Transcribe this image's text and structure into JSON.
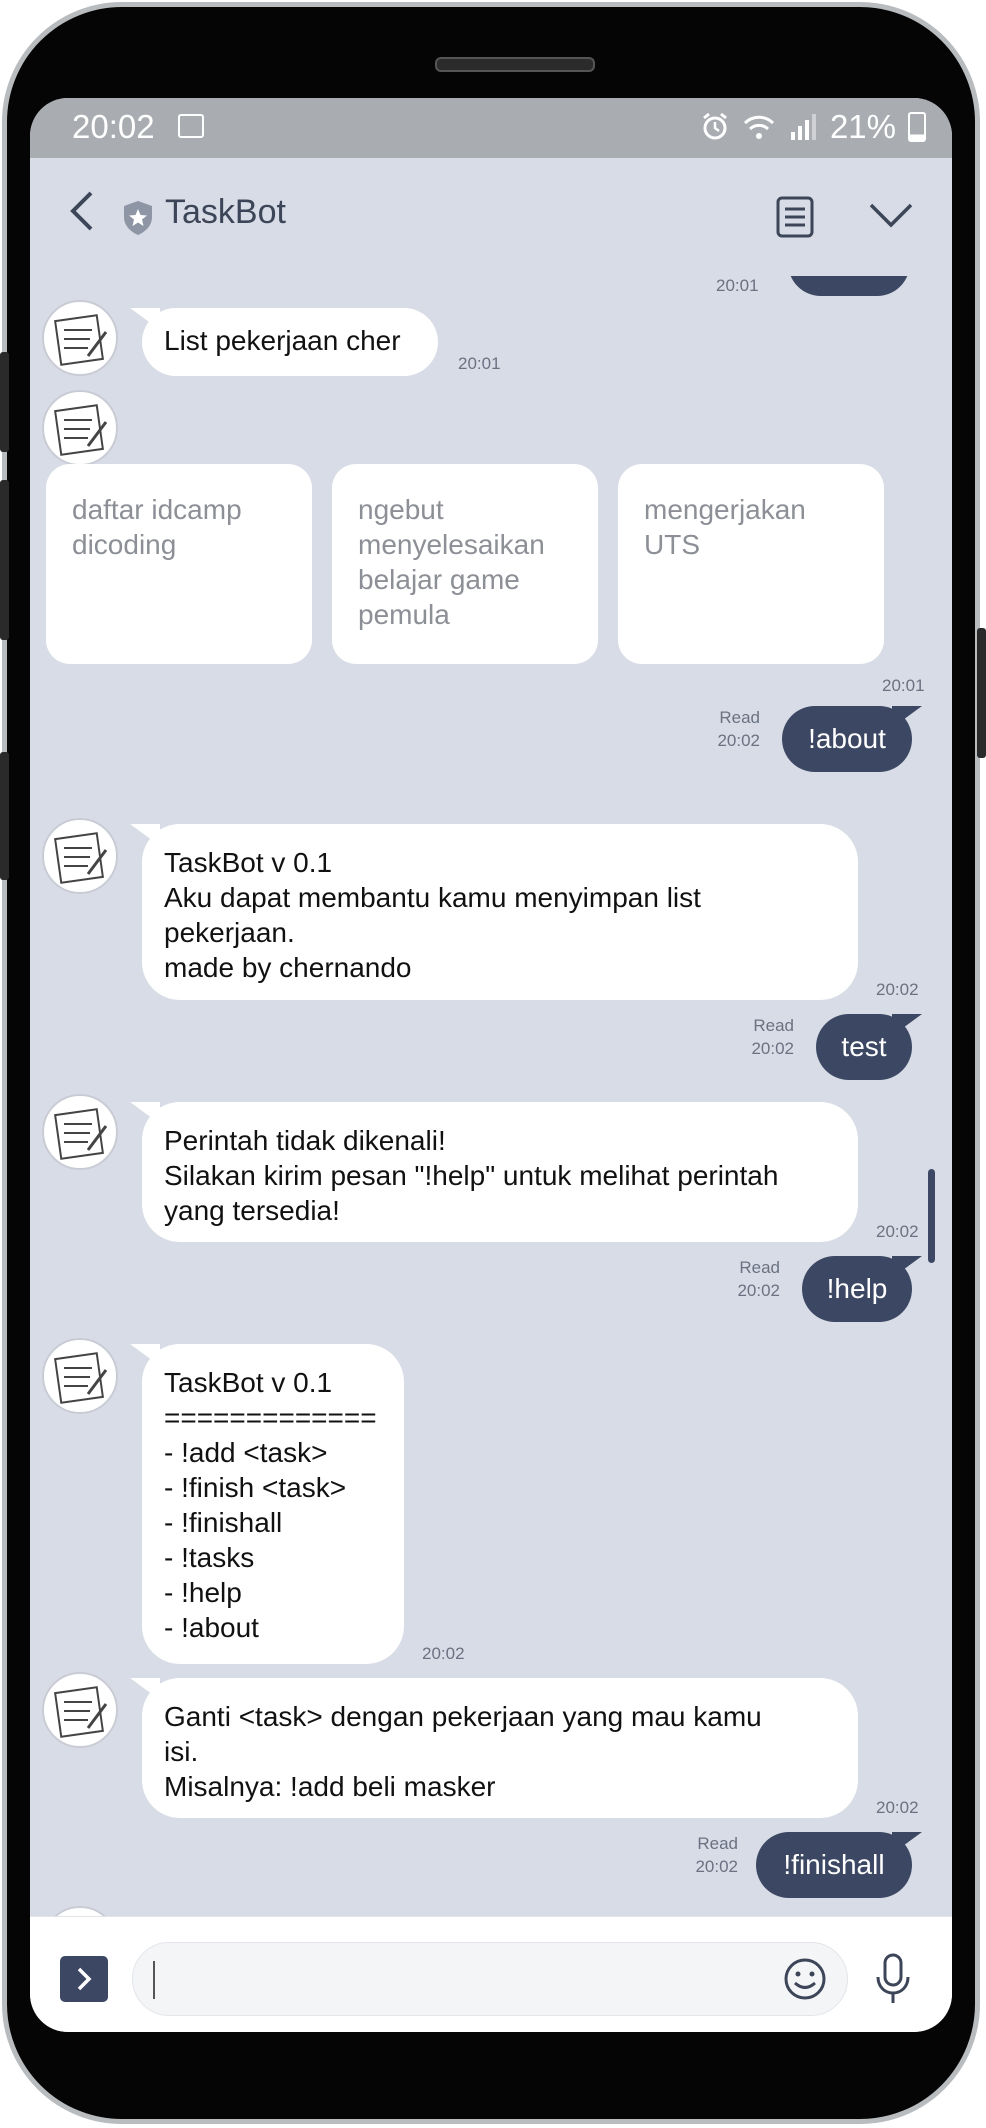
{
  "status_bar": {
    "time": "20:02",
    "battery": "21%"
  },
  "header": {
    "title": "TaskBot"
  },
  "messages": {
    "m1": {
      "text": "List pekerjaan cher",
      "time": "20:01"
    },
    "cards": [
      "daftar idcamp\ndicoding",
      "ngebut\nmenyelesaikan\nbelajar game\npemula",
      "mengerjakan\nUTS"
    ],
    "cards_time": "20:01",
    "o1": {
      "text": "!about",
      "status": "Read",
      "time": "20:02"
    },
    "m2": {
      "text": "TaskBot v 0.1\nAku dapat membantu kamu menyimpan list\npekerjaan.\nmade by chernando",
      "time": "20:02"
    },
    "o2": {
      "text": "test",
      "status": "Read",
      "time": "20:02"
    },
    "m3": {
      "text": "Perintah tidak dikenali!\nSilakan kirim pesan \"!help\" untuk melihat perintah\nyang tersedia!",
      "time": "20:02"
    },
    "o3": {
      "text": "!help",
      "status": "Read",
      "time": "20:02"
    },
    "m4": {
      "text": "TaskBot v 0.1\n=============\n- !add <task>\n- !finish <task>\n- !finishall\n- !tasks\n- !help\n- !about",
      "time": "20:02"
    },
    "m5": {
      "text": "Ganti <task> dengan pekerjaan yang mau kamu\nisi.\nMisalnya: !add beli masker",
      "time": "20:02"
    },
    "o4": {
      "text": "!finishall",
      "status": "Read",
      "time": "20:02"
    },
    "top_partial_time": "20:01"
  },
  "input": {
    "value": ""
  },
  "icons": {
    "back": "back-arrow-icon",
    "shield": "shield-star-icon",
    "notes": "notes-icon",
    "menu": "chevron-down-icon",
    "expand": "chevron-right-icon",
    "emoji": "smiley-icon",
    "mic": "microphone-icon"
  }
}
